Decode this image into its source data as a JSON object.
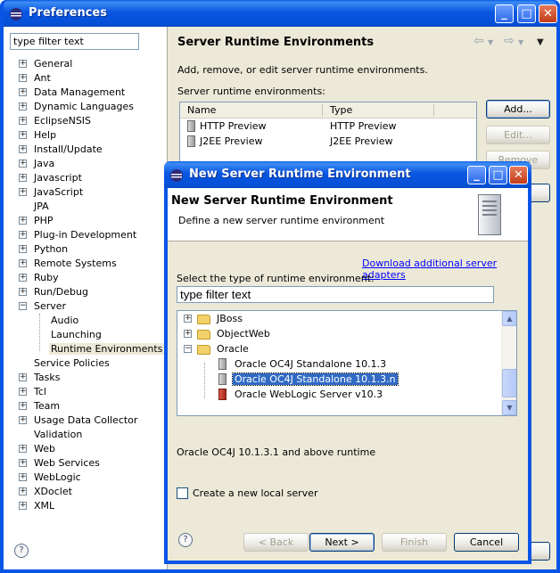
{
  "main": {
    "title": "Preferences",
    "filter_value": "type filter text",
    "tree": [
      {
        "label": "General",
        "level": 0,
        "expander": "+"
      },
      {
        "label": "Ant",
        "level": 0,
        "expander": "+"
      },
      {
        "label": "Data Management",
        "level": 0,
        "expander": "+"
      },
      {
        "label": "Dynamic Languages",
        "level": 0,
        "expander": "+"
      },
      {
        "label": "EclipseNSIS",
        "level": 0,
        "expander": "+"
      },
      {
        "label": "Help",
        "level": 0,
        "expander": "+"
      },
      {
        "label": "Install/Update",
        "level": 0,
        "expander": "+"
      },
      {
        "label": "Java",
        "level": 0,
        "expander": "+"
      },
      {
        "label": "Javascript",
        "level": 0,
        "expander": "+"
      },
      {
        "label": "JavaScript",
        "level": 0,
        "expander": "+"
      },
      {
        "label": "JPA",
        "level": 0,
        "expander": ""
      },
      {
        "label": "PHP",
        "level": 0,
        "expander": "+"
      },
      {
        "label": "Plug-in Development",
        "level": 0,
        "expander": "+"
      },
      {
        "label": "Python",
        "level": 0,
        "expander": "+"
      },
      {
        "label": "Remote Systems",
        "level": 0,
        "expander": "+"
      },
      {
        "label": "Ruby",
        "level": 0,
        "expander": "+"
      },
      {
        "label": "Run/Debug",
        "level": 0,
        "expander": "+"
      },
      {
        "label": "Server",
        "level": 0,
        "expander": "-"
      },
      {
        "label": "Audio",
        "level": 1,
        "expander": ""
      },
      {
        "label": "Launching",
        "level": 1,
        "expander": ""
      },
      {
        "label": "Runtime Environments",
        "level": 1,
        "expander": "",
        "selected": true
      },
      {
        "label": "Service Policies",
        "level": 0,
        "expander": ""
      },
      {
        "label": "Tasks",
        "level": 0,
        "expander": "+"
      },
      {
        "label": "Tcl",
        "level": 0,
        "expander": "+"
      },
      {
        "label": "Team",
        "level": 0,
        "expander": "+"
      },
      {
        "label": "Usage Data Collector",
        "level": 0,
        "expander": "+"
      },
      {
        "label": "Validation",
        "level": 0,
        "expander": ""
      },
      {
        "label": "Web",
        "level": 0,
        "expander": "+"
      },
      {
        "label": "Web Services",
        "level": 0,
        "expander": "+"
      },
      {
        "label": "WebLogic",
        "level": 0,
        "expander": "+"
      },
      {
        "label": "XDoclet",
        "level": 0,
        "expander": "+"
      },
      {
        "label": "XML",
        "level": 0,
        "expander": "+"
      }
    ],
    "page_title": "Server Runtime Environments",
    "description": "Add, remove, or edit server runtime environments.",
    "list_label": "Server runtime environments:",
    "columns": [
      "Name",
      "Type"
    ],
    "rows": [
      {
        "name": "HTTP Preview",
        "type": "HTTP Preview"
      },
      {
        "name": "J2EE Preview",
        "type": "J2EE Preview"
      }
    ],
    "buttons": {
      "add": "Add...",
      "edit": "Edit...",
      "remove": "Remove"
    }
  },
  "dialog": {
    "title": "New Server Runtime Environment",
    "banner_title": "New Server Runtime Environment",
    "banner_desc": "Define a new server runtime environment",
    "link": "Download additional server adapters",
    "select_label": "Select the type of runtime environment:",
    "filter_value": "type filter text",
    "tree": [
      {
        "label": "JBoss",
        "kind": "folder",
        "expander": "+",
        "level": 0
      },
      {
        "label": "ObjectWeb",
        "kind": "folder",
        "expander": "+",
        "level": 0
      },
      {
        "label": "Oracle",
        "kind": "folder",
        "expander": "-",
        "level": 0
      },
      {
        "label": "Oracle OC4J Standalone 10.1.3",
        "kind": "server",
        "expander": "",
        "level": 1
      },
      {
        "label": "Oracle OC4J Standalone 10.1.3.n",
        "kind": "server",
        "expander": "",
        "level": 1,
        "selected": true
      },
      {
        "label": "Oracle WebLogic Server v10.3",
        "kind": "weblogic",
        "expander": "",
        "level": 1
      }
    ],
    "selection_desc": "Oracle OC4J 10.1.3.1 and above runtime",
    "checkbox_label": "Create a new local server",
    "buttons": {
      "back": "< Back",
      "next": "Next >",
      "finish": "Finish",
      "cancel": "Cancel"
    }
  },
  "colors": {
    "titlebar": "#0a55e6",
    "selection": "#316ac5",
    "link": "#0000ff"
  }
}
